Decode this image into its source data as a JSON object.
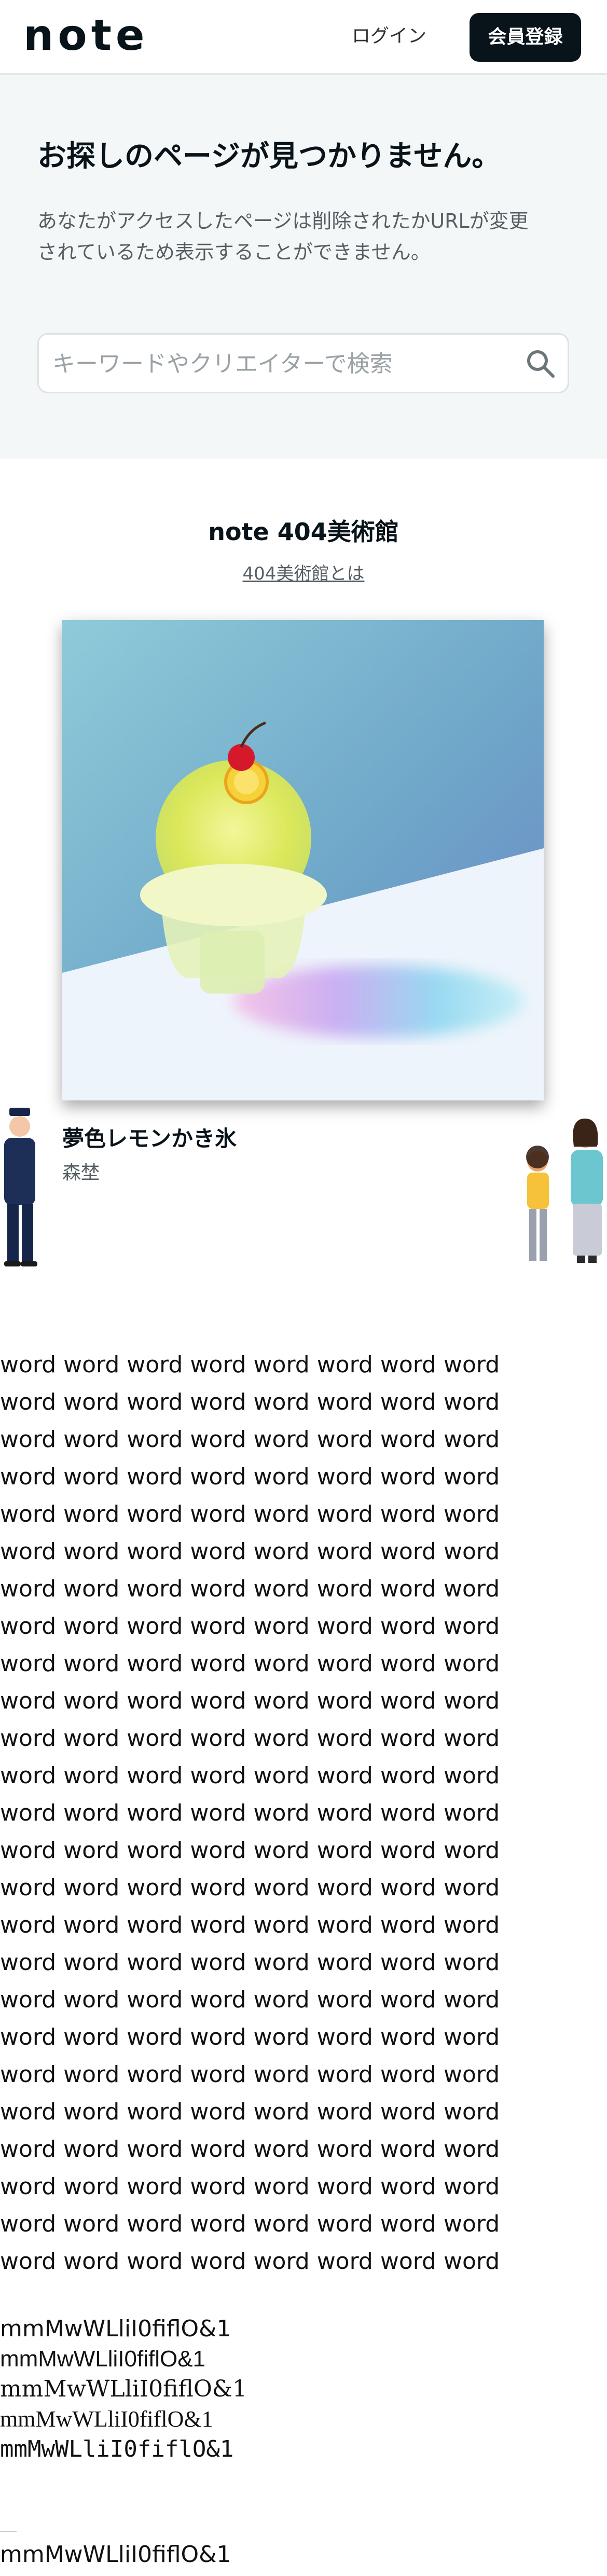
{
  "header": {
    "logo_text": "note",
    "login_label": "ログイン",
    "signup_label": "会員登録"
  },
  "error": {
    "title": "お探しのページが見つかりません。",
    "description": "あなたがアクセスしたページは削除されたかURLが変更されているため表示することができません。",
    "search_placeholder": "キーワードやクリエイターで検索",
    "search_value": ""
  },
  "museum": {
    "title": "note 404美術館",
    "about_link": "404美術館とは",
    "artwork_title": "夢色レモンかき氷",
    "artwork_author": "森埜"
  },
  "icons": {
    "search": "search-icon",
    "logo": "note-logo"
  },
  "colors": {
    "brand_dark": "#08131a",
    "error_bg": "#f4f7f8",
    "link_gray": "#555e63"
  },
  "font_test": {
    "word_lines": [
      "word word word word word word word word",
      "word word word word word word word word",
      "word word word word word word word word",
      "word word word word word word word word",
      "word word word word word word word word",
      "word word word word word word word word",
      "word word word word word word word word",
      "word word word word word word word word",
      "word word word word word word word word",
      "word word word word word word word word",
      "word word word word word word word word",
      "word word word word word word word word",
      "word word word word word word word word",
      "word word word word word word word word",
      "word word word word word word word word",
      "word word word word word word word word",
      "word word word word word word word word",
      "word word word word word word word word",
      "word word word word word word word word",
      "word word word word word word word word",
      "word word word word word word word word",
      "word word word word word word word word",
      "word word word word word word word word",
      "word word word word word word word word",
      "word word word word word word word word"
    ],
    "glyph_lines": [
      "mmMwWLliI0fiflO&1",
      "mmMwWLliI0fiflO&1",
      "mmMwWLliI0fiflO&1",
      "mmMwWLliI0fiflO&1",
      "mmMwWLliI0fiflO&1",
      "mmMwWLliI0fiflO&1"
    ]
  }
}
